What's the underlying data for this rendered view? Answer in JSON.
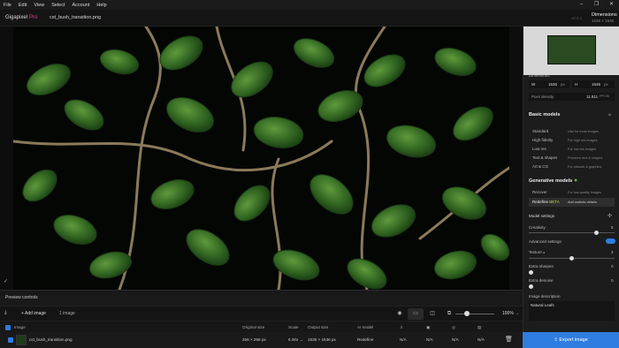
{
  "menu": [
    "File",
    "Edit",
    "View",
    "Select",
    "Account",
    "Help"
  ],
  "app": {
    "name": "Gigapixel",
    "badge": "Pro",
    "filename": "cst_bush_transition.png",
    "version": "v8.0.1"
  },
  "dimensions": {
    "title": "Dimensions",
    "value": "1536 × 1536"
  },
  "canvas": {
    "image_alt": "green leaves and branches on black background"
  },
  "preview_controls": "Preview controls",
  "controls": {
    "add_image": "Add image",
    "image_count": "1 image",
    "zoom": "100%"
  },
  "table": {
    "headers": {
      "image": "Image",
      "original_size": "Original size",
      "scale": "Scale",
      "output_size": "Output size",
      "ai_model": "AI model"
    },
    "row": {
      "name": "cst_bush_transition.png",
      "original_size": "256 × 256 px",
      "scale": "6.00x →",
      "output_size": "1536 × 1536 px",
      "ai_model": "Redefine",
      "c1": "N/A",
      "c2": "N/A",
      "c3": "N/A",
      "c4": "N/A"
    }
  },
  "panel": {
    "dimensions_label": "Dimensions",
    "w_label": "W",
    "w_value": "1536",
    "w_unit": "px",
    "h_label": "H",
    "h_value": "1536",
    "h_unit": "px",
    "pixel_density_label": "Pixel density",
    "pixel_density_value": "11.811",
    "pixel_density_unit": "PPCM",
    "basic_models_title": "Basic models",
    "basic_models": [
      {
        "name": "Standard",
        "desc": "Use for most images"
      },
      {
        "name": "High fidelity",
        "desc": "For high res images"
      },
      {
        "name": "Low res",
        "desc": "For low res images"
      },
      {
        "name": "Text & shapes",
        "desc": "Preserve text & shapes"
      },
      {
        "name": "Art & CG",
        "desc": "For artwork & graphics"
      }
    ],
    "gen_models_title": "Generative models",
    "gen_models": [
      {
        "name": "Recover",
        "desc": "For low-quality images"
      },
      {
        "name": "Redefine",
        "badge": "BETA",
        "desc": "Add realistic details"
      }
    ],
    "model_settings_title": "Model settings",
    "creativity_label": "Creativity",
    "creativity_value": "5",
    "advanced_label": "Advanced settings",
    "texture_label": "Texture",
    "texture_value": "3",
    "sharpen_label": "Extra sharpen",
    "sharpen_value": "0",
    "denoise_label": "Extra denoise",
    "denoise_value": "0",
    "description_label": "Image description",
    "description_value": "Natural Leafs"
  },
  "export_label": "Export image",
  "colors": {
    "accent": "#2f7de0",
    "pro": "#e0408a"
  }
}
